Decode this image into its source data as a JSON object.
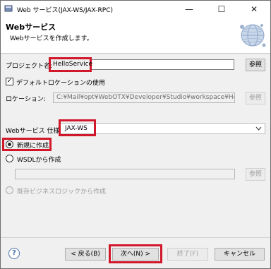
{
  "window": {
    "title": "Web サービス(JAX-WS/JAX-RPC)",
    "minimize_glyph": "—",
    "maximize_glyph": "☐",
    "close_glyph": "✕"
  },
  "header": {
    "title": "Webサービス",
    "subtitle": "Webサービスを作成します。"
  },
  "form": {
    "project_label": "プロジェクト名:",
    "project_value": "HelloService",
    "browse_label": "参照",
    "default_location_label": "デフォルトロケーションの使用",
    "location_label": "ロケーション:",
    "location_value": "C:¥Mail¥opt¥WebOTX¥Developer¥Studio¥workspace¥HelloServic",
    "spec_label": "Webサービス 仕様:",
    "spec_value": "JAX-WS",
    "radio_new": "新規に作成",
    "radio_wsdl": "WSDLから作成",
    "radio_existing": "既存ビジネスロジックから作成"
  },
  "footer": {
    "help_glyph": "?",
    "back": "< 戻る(B)",
    "next": "次へ(N) >",
    "finish": "終了(F)",
    "cancel": "キャンセル"
  }
}
